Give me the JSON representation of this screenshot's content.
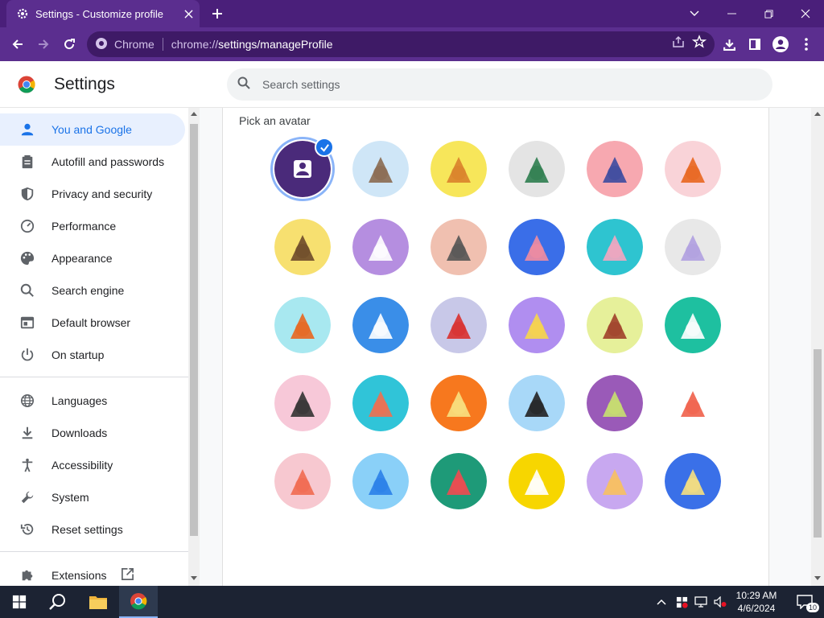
{
  "window": {
    "tab_title": "Settings - Customize profile",
    "icons": {
      "tab": "gear-icon",
      "close": "close-icon",
      "new_tab": "plus-icon",
      "tab_search": "chevron-down-icon",
      "minimize": "minimize-icon",
      "restore": "restore-icon",
      "close_window": "close-icon"
    }
  },
  "toolbar": {
    "site_label": "Chrome",
    "url_scheme": "chrome://",
    "url_path": "settings/manageProfile",
    "icons": [
      "back-icon",
      "forward-icon",
      "reload-icon",
      "share-icon",
      "star-icon",
      "download-icon",
      "side-panel-icon",
      "profile-icon",
      "menu-icon"
    ]
  },
  "header": {
    "title": "Settings",
    "search_placeholder": "Search settings"
  },
  "sidebar": {
    "items": [
      {
        "label": "You and Google",
        "icon": "person-icon",
        "active": true
      },
      {
        "label": "Autofill and passwords",
        "icon": "clipboard-icon",
        "active": false
      },
      {
        "label": "Privacy and security",
        "icon": "shield-icon",
        "active": false
      },
      {
        "label": "Performance",
        "icon": "speedometer-icon",
        "active": false
      },
      {
        "label": "Appearance",
        "icon": "palette-icon",
        "active": false
      },
      {
        "label": "Search engine",
        "icon": "search-icon",
        "active": false
      },
      {
        "label": "Default browser",
        "icon": "browser-icon",
        "active": false
      },
      {
        "label": "On startup",
        "icon": "power-icon",
        "active": false
      },
      {
        "label": "Languages",
        "icon": "globe-icon",
        "active": false
      },
      {
        "label": "Downloads",
        "icon": "download-icon",
        "active": false
      },
      {
        "label": "Accessibility",
        "icon": "accessibility-icon",
        "active": false
      },
      {
        "label": "System",
        "icon": "wrench-icon",
        "active": false
      },
      {
        "label": "Reset settings",
        "icon": "reset-icon",
        "active": false
      },
      {
        "label": "Extensions",
        "icon": "puzzle-icon",
        "active": false
      }
    ]
  },
  "main": {
    "section_label": "Pick an avatar",
    "avatars": [
      {
        "name": "generic-person",
        "bg": "#4a2a7a",
        "fg": "#ffffff",
        "selected": true
      },
      {
        "name": "cat",
        "bg": "#cfe6f7",
        "fg": "#8a6a50"
      },
      {
        "name": "corgi",
        "bg": "#f7e65a",
        "fg": "#d9822b"
      },
      {
        "name": "dragon",
        "bg": "#e4e4e4",
        "fg": "#2e7d4f"
      },
      {
        "name": "elephant",
        "bg": "#f7a8b0",
        "fg": "#3c4aa0"
      },
      {
        "name": "fox",
        "bg": "#f9d3d8",
        "fg": "#e8661f"
      },
      {
        "name": "monkey",
        "bg": "#f7e070",
        "fg": "#6d4a2a"
      },
      {
        "name": "panda",
        "bg": "#b58ee0",
        "fg": "#ffffff"
      },
      {
        "name": "penguin",
        "bg": "#f0c0b0",
        "fg": "#555555"
      },
      {
        "name": "butterfly",
        "bg": "#3a6ee8",
        "fg": "#f28ca0"
      },
      {
        "name": "rabbit",
        "bg": "#2ec4d0",
        "fg": "#f4a6c0"
      },
      {
        "name": "unicorn",
        "bg": "#e8e8e8",
        "fg": "#b0a0e0"
      },
      {
        "name": "basketball",
        "bg": "#a8e8f0",
        "fg": "#e8661f"
      },
      {
        "name": "bike",
        "bg": "#3a8ee8",
        "fg": "#ffffff"
      },
      {
        "name": "bird",
        "bg": "#c8c8e8",
        "fg": "#d9302e"
      },
      {
        "name": "cheese",
        "bg": "#b08ef0",
        "fg": "#f7d64a"
      },
      {
        "name": "football",
        "bg": "#e6f09a",
        "fg": "#a0402a"
      },
      {
        "name": "ramen",
        "bg": "#1ec0a0",
        "fg": "#ffffff"
      },
      {
        "name": "sunglasses",
        "bg": "#f7c8d8",
        "fg": "#333333"
      },
      {
        "name": "sushi",
        "bg": "#30c4d8",
        "fg": "#f07050"
      },
      {
        "name": "tamagotchi",
        "bg": "#f7781e",
        "fg": "#f7e080"
      },
      {
        "name": "vinyl",
        "bg": "#a8d8f8",
        "fg": "#222222"
      },
      {
        "name": "avocado",
        "bg": "#9a5ab8",
        "fg": "#c8e070"
      },
      {
        "name": "smile",
        "bg": "#ffffff",
        "fg": "#f0604a"
      },
      {
        "name": "ice-cream",
        "bg": "#f7c8d0",
        "fg": "#f06a50"
      },
      {
        "name": "origami-blue",
        "bg": "#8ad0f8",
        "fg": "#2a80e8"
      },
      {
        "name": "watermelon",
        "bg": "#1e9a78",
        "fg": "#f04a50"
      },
      {
        "name": "onigiri",
        "bg": "#f7d600",
        "fg": "#ffffff"
      },
      {
        "name": "pizza",
        "bg": "#c8a8f0",
        "fg": "#f7c060"
      },
      {
        "name": "sandwich",
        "bg": "#3a70e8",
        "fg": "#f7e080"
      }
    ]
  },
  "taskbar": {
    "time": "10:29 AM",
    "date": "4/6/2024",
    "notification_count": "10",
    "icons": [
      "windows-start-icon",
      "search-icon",
      "file-explorer-icon",
      "chrome-icon",
      "chevron-up-icon",
      "security-icon",
      "network-icon",
      "volume-muted-icon",
      "notification-icon"
    ]
  },
  "colors": {
    "accent": "#1a73e8",
    "frame": "#4a1f7a",
    "toolbar": "#5b2e8f"
  }
}
